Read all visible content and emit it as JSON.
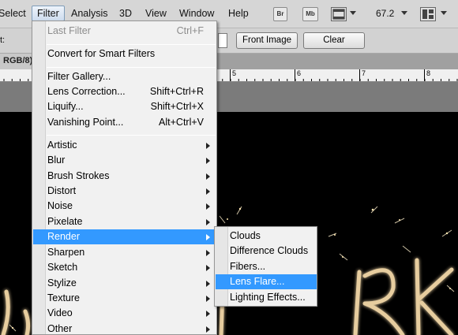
{
  "menubar": {
    "items": [
      "Select",
      "Filter",
      "Analysis",
      "3D",
      "View",
      "Window",
      "Help"
    ],
    "bridge_label": "Br",
    "minibridge_label": "Mb",
    "zoom": "67.2"
  },
  "options": {
    "field_label": "t:",
    "front_image": "Front Image",
    "clear": "Clear"
  },
  "document": {
    "tab": "RGB/8)"
  },
  "ruler": {
    "numbers": [
      "5",
      "6",
      "7",
      "8"
    ]
  },
  "filter_menu": {
    "last_filter": {
      "label": "Last Filter",
      "shortcut": "Ctrl+F"
    },
    "convert": "Convert for Smart Filters",
    "filter_gallery": "Filter Gallery...",
    "lens_correction": {
      "label": "Lens Correction...",
      "shortcut": "Shift+Ctrl+R"
    },
    "liquify": {
      "label": "Liquify...",
      "shortcut": "Shift+Ctrl+X"
    },
    "vanishing_point": {
      "label": "Vanishing Point...",
      "shortcut": "Alt+Ctrl+V"
    },
    "submenus": [
      "Artistic",
      "Blur",
      "Brush Strokes",
      "Distort",
      "Noise",
      "Pixelate",
      "Render",
      "Sharpen",
      "Sketch",
      "Stylize",
      "Texture",
      "Video",
      "Other"
    ]
  },
  "render_menu": {
    "items": [
      "Clouds",
      "Difference Clouds",
      "Fibers...",
      "Lens Flare...",
      "Lighting Effects..."
    ],
    "highlighted": "Lens Flare..."
  },
  "colors": {
    "highlight": "#3399ff",
    "menu_bg": "#f1f1f1",
    "canvas": "#000000"
  }
}
